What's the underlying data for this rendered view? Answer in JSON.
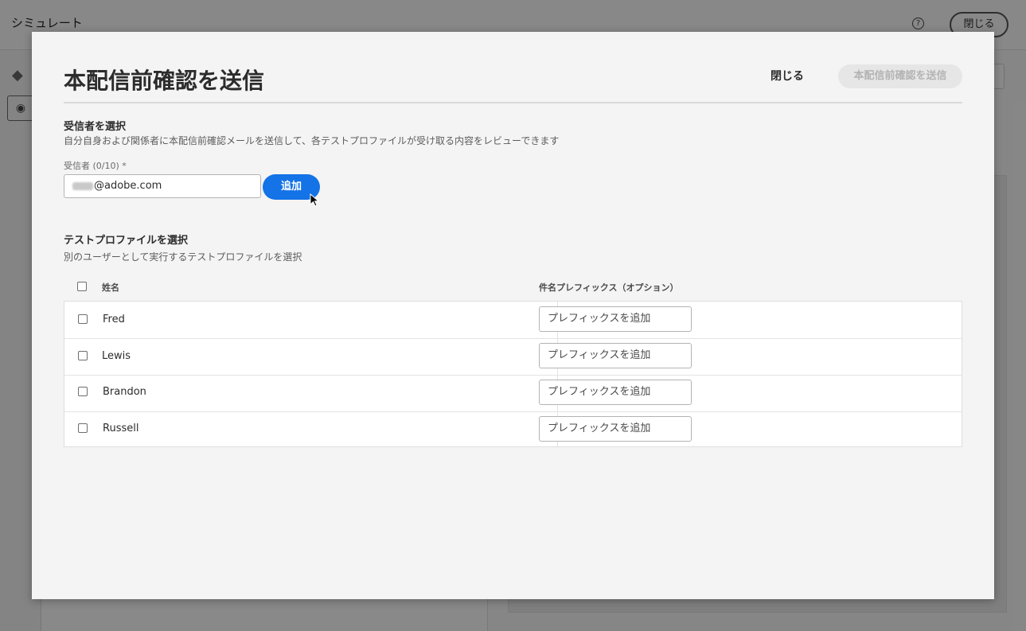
{
  "background": {
    "app_title": "シミュレート",
    "help_icon": "help-icon",
    "close_label": "閉じる"
  },
  "dialog": {
    "title": "本配信前確認を送信",
    "close_label": "閉じる",
    "send_label": "本配信前確認を送信",
    "recipients": {
      "section_title": "受信者を選択",
      "description": "自分自身および関係者に本配信前確認メールを送信して、各テストプロファイルが受け取る内容をレビューできます",
      "field_label": "受信者 (0/10) *",
      "email_value": "@adobe.com",
      "add_label": "追加"
    },
    "profiles": {
      "section_title": "テストプロファイルを選択",
      "description": "別のユーザーとして実行するテストプロファイルを選択",
      "col_name": "姓名",
      "col_prefix": "件名プレフィックス（オプション）",
      "rows": [
        {
          "name": "Fred",
          "prefix_placeholder": "プレフィックスを追加"
        },
        {
          "name": "Lewis",
          "prefix_placeholder": "プレフィックスを追加"
        },
        {
          "name": "Brandon",
          "prefix_placeholder": "プレフィックスを追加"
        },
        {
          "name": "Russell",
          "prefix_placeholder": "プレフィックスを追加"
        }
      ]
    }
  },
  "colors": {
    "accent": "#1473e6",
    "dialog_bg": "#f4f4f4"
  }
}
